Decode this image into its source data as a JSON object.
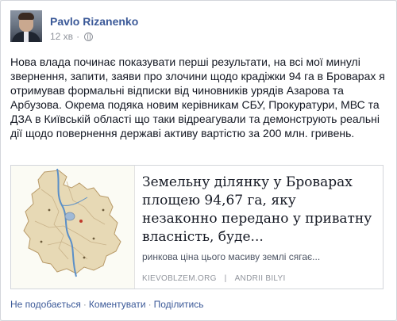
{
  "post": {
    "author": "Pavlo Rizanenko",
    "time": "12 хв",
    "meta_separator": "·",
    "paragraph": "Нова влада починає показувати перші результати, на всі мої минулі звернення, запити, заяви про злочини щодо крадіжки 94 га в Броварах я отримував формальні відписки від чиновників урядів Азарова та Арбузова. Окрема подяка новим керівникам СБУ, Прокуратури, МВС та ДЗА в Київській області що таки відреагували та демонструють реальні дії щодо повернення державі активу вартістю за 200 млн. гривень."
  },
  "link": {
    "title": "Земельну ділянку у Броварах площею 94,67 га, яку незаконно передано у приватну власність, буде...",
    "description": "ринкова ціна цього масиву землі сягає...",
    "domain": "KIEVOBLZEM.ORG",
    "separator": "|",
    "author": "ANDRII BILYI"
  },
  "actions": {
    "like": "Не подобається",
    "comment": "Коментувати",
    "share": "Поділитись",
    "separator": "·"
  },
  "icons": {
    "globe": "globe-icon",
    "thumbnail": "kyiv-region-map"
  },
  "colors": {
    "link_blue": "#3b5998",
    "muted": "#90949c",
    "text": "#141823"
  }
}
